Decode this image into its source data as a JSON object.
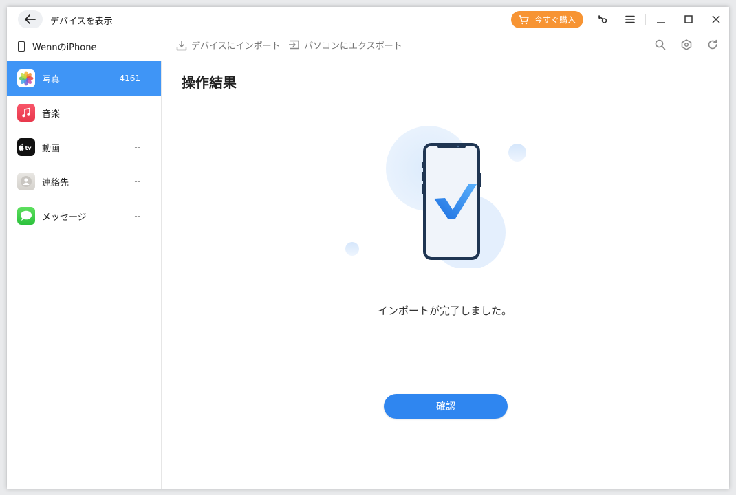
{
  "titlebar": {
    "title": "デバイスを表示",
    "buy_label": "今すぐ購入"
  },
  "toolbar": {
    "device_name": "WennのiPhone",
    "import_label": "デバイスにインポート",
    "export_label": "パソコンにエクスポート"
  },
  "sidebar": {
    "items": [
      {
        "label": "写真",
        "count": "4161"
      },
      {
        "label": "音楽",
        "count": "--"
      },
      {
        "label": "動画",
        "count": "--"
      },
      {
        "label": "連絡先",
        "count": "--"
      },
      {
        "label": "メッセージ",
        "count": "--"
      }
    ]
  },
  "main": {
    "title": "操作結果",
    "result_text": "インポートが完了しました。",
    "confirm_label": "確認"
  },
  "colors": {
    "accent": "#3f95f6",
    "buy": "#f79433",
    "confirm": "#2f86f0"
  }
}
